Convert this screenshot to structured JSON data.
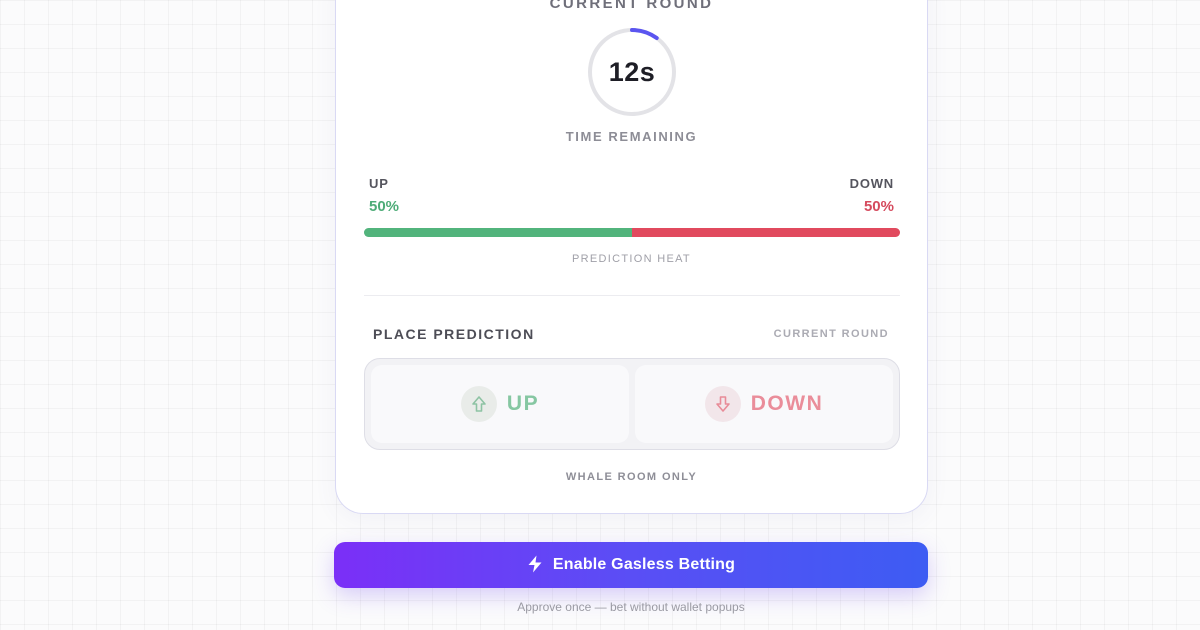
{
  "round": {
    "title": "CURRENT ROUND",
    "timer_value": "12s",
    "timer_progress": 0.1,
    "timer_label": "TIME REMAINING"
  },
  "heat": {
    "up_label": "UP",
    "up_percent": "50%",
    "up_fraction": 0.5,
    "down_label": "DOWN",
    "down_percent": "50%",
    "caption": "PREDICTION HEAT"
  },
  "prediction": {
    "title": "PLACE PREDICTION",
    "subtitle": "CURRENT ROUND",
    "up_button": "UP",
    "up_icon": "arrow-up-icon",
    "down_button": "DOWN",
    "down_icon": "arrow-down-icon",
    "note": "WHALE ROOM ONLY"
  },
  "cta": {
    "icon": "lightning-icon",
    "label": "Enable Gasless Betting",
    "note": "Approve once — bet without wallet popups"
  },
  "colors": {
    "up": "#52b47c",
    "down": "#e14a5e",
    "accent_start": "#7b2ff7",
    "accent_end": "#3d5cf3",
    "timer_arc": "#5b55f0"
  }
}
